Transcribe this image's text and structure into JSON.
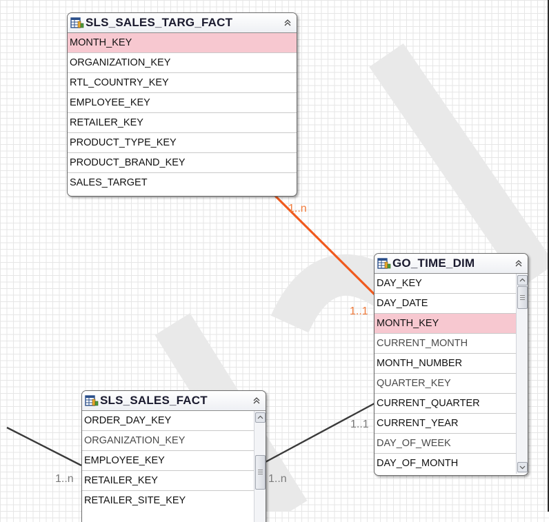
{
  "colors": {
    "highlight_row": "#f7c8d0",
    "relationship_active": "#f05a1e",
    "relationship_default": "#3a3a3a",
    "cardinality_active": "#f07a3a",
    "cardinality_default": "#7a7a7a"
  },
  "entities": {
    "sls_sales_targ_fact": {
      "title": "SLS_SALES_TARG_FACT",
      "icon": "table-icon",
      "rows": [
        {
          "label": "MONTH_KEY",
          "highlighted": true
        },
        {
          "label": "ORGANIZATION_KEY"
        },
        {
          "label": "RTL_COUNTRY_KEY"
        },
        {
          "label": "EMPLOYEE_KEY"
        },
        {
          "label": "RETAILER_KEY"
        },
        {
          "label": "PRODUCT_TYPE_KEY"
        },
        {
          "label": "PRODUCT_BRAND_KEY"
        },
        {
          "label": "SALES_TARGET"
        }
      ]
    },
    "go_time_dim": {
      "title": "GO_TIME_DIM",
      "icon": "table-icon",
      "rows": [
        {
          "label": "DAY_KEY"
        },
        {
          "label": "DAY_DATE"
        },
        {
          "label": "MONTH_KEY",
          "highlighted": true
        },
        {
          "label": "CURRENT_MONTH"
        },
        {
          "label": "MONTH_NUMBER"
        },
        {
          "label": "QUARTER_KEY"
        },
        {
          "label": "CURRENT_QUARTER"
        },
        {
          "label": "CURRENT_YEAR"
        },
        {
          "label": "DAY_OF_WEEK"
        },
        {
          "label": "DAY_OF_MONTH"
        }
      ]
    },
    "sls_sales_fact": {
      "title": "SLS_SALES_FACT",
      "icon": "table-icon",
      "rows": [
        {
          "label": "ORDER_DAY_KEY"
        },
        {
          "label": "ORGANIZATION_KEY"
        },
        {
          "label": "EMPLOYEE_KEY"
        },
        {
          "label": "RETAILER_KEY"
        },
        {
          "label": "RETAILER_SITE_KEY"
        }
      ]
    }
  },
  "relationships": [
    {
      "from": "SLS_SALES_TARG_FACT",
      "to": "GO_TIME_DIM",
      "from_card": "1..n",
      "to_card": "1..1",
      "selected": true
    },
    {
      "from": "SLS_SALES_FACT",
      "to": "GO_TIME_DIM",
      "from_card": "1..n",
      "to_card": "1..1",
      "selected": false
    },
    {
      "from": "(offscreen)",
      "to": "SLS_SALES_FACT",
      "to_card": "1..n",
      "selected": false
    }
  ]
}
